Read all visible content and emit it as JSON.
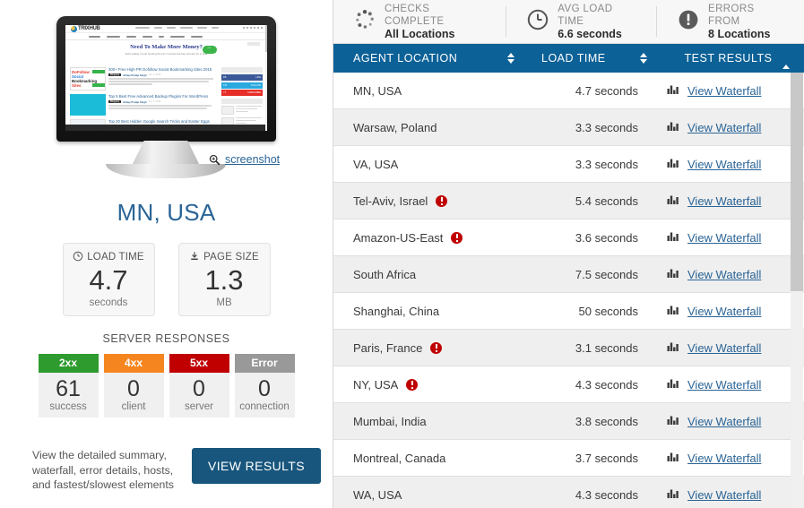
{
  "left": {
    "screenshot_link": "screenshot",
    "screenshot_icon": "magnifier-icon",
    "location_title": "MN, USA",
    "thumbnail": {
      "site_logo": "TRIXHUB",
      "hero_title": "Need To Make More Money?",
      "hero_sub": "Start selling or just hosting the No.1 trusted ad-free domain for a Year",
      "post1_title": "300+ Free High PR Dofollow Social Bookmarking Sites 2015",
      "post1_thumb_lines": [
        "DoFollow",
        "Social",
        "Bookmarking",
        "Sites"
      ],
      "post2_title": "Top 5 Best Free Advanced Backup Plugins For WordPress",
      "post3_title": "Top 20 Best Hidden Google Search Tricks and Easter Eggs",
      "badge": "Blogging",
      "author": "Abhay Pratap Singh"
    },
    "metrics": [
      {
        "label": "LOAD TIME",
        "icon": "clock-icon",
        "value": "4.7",
        "unit": "seconds"
      },
      {
        "label": "PAGE SIZE",
        "icon": "download-icon",
        "value": "1.3",
        "unit": "MB"
      }
    ],
    "server_responses": {
      "title": "SERVER RESPONSES",
      "items": [
        {
          "code": "2xx",
          "count": "61",
          "label": "success",
          "color": "#2e9b2e"
        },
        {
          "code": "4xx",
          "count": "0",
          "label": "client",
          "color": "#f5861f"
        },
        {
          "code": "5xx",
          "count": "0",
          "label": "server",
          "color": "#c00000"
        },
        {
          "code": "Error",
          "count": "0",
          "label": "connection",
          "color": "#999999"
        }
      ]
    },
    "footer": {
      "text": "View the detailed summary, waterfall, error details, hosts, and fastest/slowest elements",
      "button": "VIEW RESULTS"
    }
  },
  "right": {
    "summary": [
      {
        "icon": "spinner-dots-icon",
        "label": "CHECKS COMPLETE",
        "value": "All Locations"
      },
      {
        "icon": "clock-icon",
        "label": "AVG LOAD TIME",
        "value": "6.6 seconds"
      },
      {
        "icon": "error-exclamation-icon",
        "label": "ERRORS FROM",
        "value": "8 Locations"
      }
    ],
    "table": {
      "headers": [
        "AGENT LOCATION",
        "LOAD TIME",
        "TEST RESULTS"
      ],
      "sort_state": "test-results-ascending",
      "link_label": "View Waterfall",
      "rows": [
        {
          "location": "MN, USA",
          "error": false,
          "time": "4.7 seconds"
        },
        {
          "location": "Warsaw, Poland",
          "error": false,
          "time": "3.3 seconds"
        },
        {
          "location": "VA, USA",
          "error": false,
          "time": "3.3 seconds"
        },
        {
          "location": "Tel-Aviv, Israel",
          "error": true,
          "time": "5.4 seconds"
        },
        {
          "location": "Amazon-US-East",
          "error": true,
          "time": "3.6 seconds"
        },
        {
          "location": "South Africa",
          "error": false,
          "time": "7.5 seconds"
        },
        {
          "location": "Shanghai, China",
          "error": false,
          "time": "50 seconds"
        },
        {
          "location": "Paris, France",
          "error": true,
          "time": "3.1 seconds"
        },
        {
          "location": "NY, USA",
          "error": true,
          "time": "4.3 seconds"
        },
        {
          "location": "Mumbai, India",
          "error": false,
          "time": "3.8 seconds"
        },
        {
          "location": "Montreal, Canada",
          "error": false,
          "time": "3.7 seconds"
        },
        {
          "location": "WA, USA",
          "error": false,
          "time": "4.3 seconds"
        }
      ]
    }
  },
  "colors": {
    "header_blue": "#0c6197",
    "link_blue": "#2a6496",
    "button_blue": "#18567d",
    "error_red": "#c00000"
  }
}
